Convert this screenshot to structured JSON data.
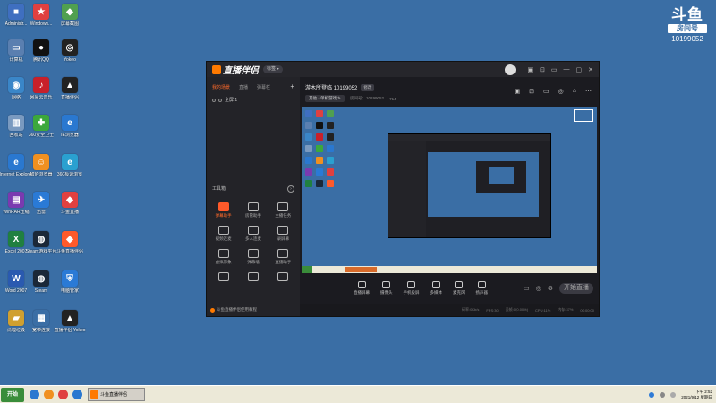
{
  "desktop_icons": [
    {
      "label": "Administr...",
      "color": "#3f6fc0",
      "glyph": "■"
    },
    {
      "label": "Windows...",
      "color": "#e04040",
      "glyph": "★"
    },
    {
      "label": "屏幕截图",
      "color": "#50a050",
      "glyph": "◆"
    },
    {
      "label": "计算机",
      "color": "#5a7fb0",
      "glyph": "▭"
    },
    {
      "label": "腾讯QQ",
      "color": "#111111",
      "glyph": "●"
    },
    {
      "label": "Yokeo",
      "color": "#222222",
      "glyph": "◎"
    },
    {
      "label": "网络",
      "color": "#3a86c8",
      "glyph": "◉"
    },
    {
      "label": "网易云音乐",
      "color": "#c8202a",
      "glyph": "♪"
    },
    {
      "label": "直播伴侣",
      "color": "#222222",
      "glyph": "▲"
    },
    {
      "label": "回收站",
      "color": "#7a9ac0",
      "glyph": "▥"
    },
    {
      "label": "360安全卫士",
      "color": "#3ca83c",
      "glyph": "✚"
    },
    {
      "label": "IE浏览器",
      "color": "#2a78d0",
      "glyph": "e"
    },
    {
      "label": "Internet Explorer",
      "color": "#2a78d0",
      "glyph": "e"
    },
    {
      "label": "猎豹浏览器",
      "color": "#f09020",
      "glyph": "☺"
    },
    {
      "label": "360极速浏览",
      "color": "#2aa0d0",
      "glyph": "e"
    },
    {
      "label": "WinRAR压缩",
      "color": "#7a3ab0",
      "glyph": "▤"
    },
    {
      "label": "迅雷",
      "color": "#2a7ad6",
      "glyph": "✈"
    },
    {
      "label": "斗鱼直播",
      "color": "#e04040",
      "glyph": "◆"
    },
    {
      "label": "Excel 2007",
      "color": "#208040",
      "glyph": "X"
    },
    {
      "label": "Steam游戏平台",
      "color": "#1b2838",
      "glyph": "◍"
    },
    {
      "label": "斗鱼直播伴侣",
      "color": "#ff5a2a",
      "glyph": "◆"
    },
    {
      "label": "Word 2007",
      "color": "#2a5ab0",
      "glyph": "W"
    },
    {
      "label": "Steam",
      "color": "#1b2838",
      "glyph": "◍"
    },
    {
      "label": "电脑管家",
      "color": "#2a7ad6",
      "glyph": "⛨"
    },
    {
      "label": "清理垃圾",
      "color": "#d0a030",
      "glyph": "▰"
    },
    {
      "label": "宽带连接",
      "color": "#3a6ea5",
      "glyph": "▦"
    },
    {
      "label": "直播伴侣 Yokeo",
      "color": "#222222",
      "glyph": "▲"
    }
  ],
  "watermark": {
    "logo": "斗鱼",
    "subtitle": "房间号",
    "room": "10199052"
  },
  "window": {
    "app_name": "直播伴侣",
    "version_badge": "标签 ▸",
    "title_icons": [
      "▣",
      "⊡",
      "▭",
      "—",
      "▢",
      "✕"
    ],
    "scene_tabs": [
      "我的场景",
      "直播",
      "弹幕栏"
    ],
    "scene_plus": "+",
    "scene_item": "全屏 1",
    "tools_label": "工具箱",
    "tools_more": "›",
    "tools": [
      {
        "label": "弹幕助手",
        "hot": true
      },
      {
        "label": "房管助手",
        "hot": false
      },
      {
        "label": "主播任务",
        "hot": false
      },
      {
        "label": "视频连麦",
        "hot": false
      },
      {
        "label": "多人连麦",
        "hot": false
      },
      {
        "label": "录屏幕",
        "hot": false
      },
      {
        "label": "虚拟形象",
        "hot": false
      },
      {
        "label": "弹幕墙",
        "hot": false
      },
      {
        "label": "直播助手",
        "hot": false
      },
      {
        "label": "",
        "hot": false
      },
      {
        "label": "",
        "hot": false
      },
      {
        "label": "",
        "hot": false
      }
    ],
    "footer": "斗鱼直播伴侣使用教程",
    "room_title": "游木所登临 10199052",
    "room_tag": "修改",
    "category": "其他 · 单机游戏 ✎",
    "room_meta": "房间号：10199052",
    "hot_count": "714",
    "head_icons": [
      "▣",
      "⊡",
      "▭",
      "◎",
      "⌂",
      "⋯"
    ],
    "controls": [
      {
        "label": "直播屏幕"
      },
      {
        "label": "摄像头"
      },
      {
        "label": "手机投屏"
      },
      {
        "label": "多媒体"
      },
      {
        "label": "麦克风"
      },
      {
        "label": "扬声器"
      }
    ],
    "ctrl_right_icons": [
      "▭",
      "◎",
      "⚙"
    ],
    "start_label": "开始直播",
    "status_items": [
      "码率:0Kb/s",
      "FPS:30",
      "丢帧:0(0.00%)",
      "CPU:11%",
      "内存:37%",
      "00:00:00"
    ]
  },
  "taskbar": {
    "start": "开始",
    "quicklaunch_colors": [
      "#2a78d0",
      "#f09020",
      "#e04040",
      "#2a78d0"
    ],
    "active_task": "斗鱼直播伴侣",
    "time": "下午 2:52",
    "date": "2021/9/12 星期日"
  }
}
